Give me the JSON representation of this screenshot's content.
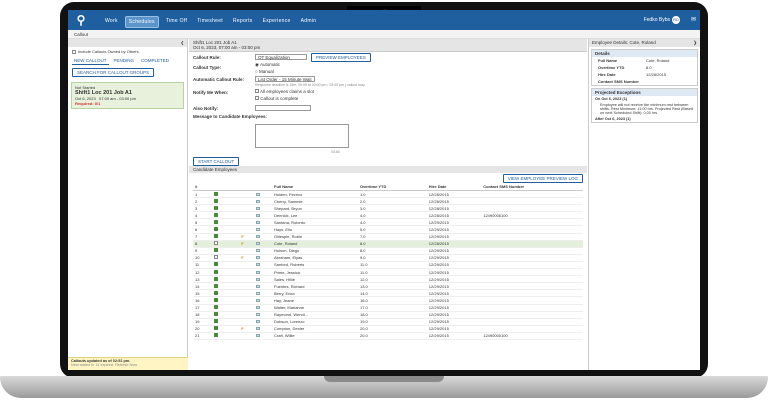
{
  "nav": {
    "items": [
      "Work",
      "Schedules",
      "Time Off",
      "Timesheet",
      "Reports",
      "Experience",
      "Admin"
    ],
    "active_index": 1
  },
  "header": {
    "user": "Fedko Bybs",
    "badge": "RD"
  },
  "breadcrumb": "Callout",
  "left": {
    "include_label": "Include Callouts Owned by Others",
    "tabs": [
      "NEW CALLOUT",
      "PENDING",
      "COMPLETED"
    ],
    "search_button": "SEARCH FOR CALLOUT GROUPS",
    "card": {
      "status": "Not Started",
      "title": "Shift1 Loc 201 Job A1",
      "date": "Oct 6, 2023",
      "time": "07:00 am - 03:00 pm",
      "req": "Required: 0/1"
    },
    "status_text": "Callouts updated as of 02:51 pm.",
    "status_sub": "New added in 14 expired. Refresh Now"
  },
  "main": {
    "title": "Shift1 Loc 201 Job A1",
    "subtitle": "Oct 6, 2023, 07:00 am - 03:00 pm",
    "callout_rule_label": "Callout Rule:",
    "callout_rule_value": "OT Equalization",
    "preview_button": "PREVIEW EMPLOYEES",
    "callout_type_label": "Callout Type:",
    "type_options": [
      "Automatic",
      "Manual"
    ],
    "auto_rule_label": "Automatic Callout Rule:",
    "auto_rule_value": "List Order - 15 Minute Wait",
    "auto_note": "Response deadline is 15m, 00:05 at 03:00 pm / 03:00 pm ( callout may",
    "notify_label": "Notify Me When:",
    "notify_options": [
      "All employees claims a slot",
      "Callout is complete"
    ],
    "also_notify_label": "Also Notify:",
    "message_label": "Message to Candidate Employees:",
    "char_count": "0/160",
    "start_button": "START CALLOUT",
    "section_title": "Candidate Employees",
    "log_button": "VIEW EMPLOYEE PREVIEW LOG",
    "columns": [
      "#",
      "",
      "",
      "",
      "",
      "Full Name",
      "Overtime YTD",
      "Hire Date",
      "Contact SMS Number"
    ],
    "rows": [
      {
        "n": "1",
        "c": true,
        "f": "",
        "name": "Holden, Pevrivo",
        "ot": "1.0",
        "hire": "12/28/2015",
        "sms": ""
      },
      {
        "n": "2",
        "c": true,
        "f": "",
        "name": "Cherry, Sammie",
        "ot": "2.0",
        "hire": "12/28/2015",
        "sms": ""
      },
      {
        "n": "3",
        "c": true,
        "f": "",
        "name": "Shepard, Bryon",
        "ot": "3.0",
        "hire": "12/28/2015",
        "sms": ""
      },
      {
        "n": "4",
        "c": true,
        "f": "",
        "name": "Dennick, Lee",
        "ot": "4.0",
        "hire": "12/28/2015",
        "sms": "12490006100"
      },
      {
        "n": "5",
        "c": true,
        "f": "",
        "name": "Santana, Roberto",
        "ot": "4.0",
        "hire": "12/29/2015",
        "sms": ""
      },
      {
        "n": "6",
        "c": true,
        "f": "",
        "name": "Hays, Elio",
        "ot": "5.0",
        "hire": "12/29/2015",
        "sms": ""
      },
      {
        "n": "7",
        "c": true,
        "f": "F",
        "name": "Gillespie, Robin",
        "ot": "7.0",
        "hire": "12/29/2015",
        "sms": ""
      },
      {
        "n": "8",
        "c": false,
        "f": "F",
        "name": "Cote, Roland",
        "ot": "8.0",
        "hire": "12/28/2015",
        "sms": "",
        "hl": true
      },
      {
        "n": "9",
        "c": true,
        "f": "",
        "name": "Holson, Diego",
        "ot": "8.0",
        "hire": "12/29/2015",
        "sms": ""
      },
      {
        "n": "10",
        "c": false,
        "f": "F",
        "name": "Abraham, Elyas",
        "ot": "9.0",
        "hire": "12/29/2015",
        "sms": ""
      },
      {
        "n": "11",
        "c": true,
        "f": "",
        "name": "Sanford, Roberts",
        "ot": "11.0",
        "hire": "12/29/2015",
        "sms": ""
      },
      {
        "n": "12",
        "c": true,
        "f": "",
        "name": "Prime, Jessica",
        "ot": "11.0",
        "hire": "12/29/2015",
        "sms": ""
      },
      {
        "n": "13",
        "c": true,
        "f": "",
        "name": "Sales, Hillie",
        "ot": "12.0",
        "hire": "12/29/2015",
        "sms": ""
      },
      {
        "n": "14",
        "c": true,
        "f": "",
        "name": "Fuentes, Richard",
        "ot": "13.0",
        "hire": "12/29/2015",
        "sms": ""
      },
      {
        "n": "15",
        "c": true,
        "f": "",
        "name": "Berry, Erica",
        "ot": "14.0",
        "hire": "12/29/2015",
        "sms": ""
      },
      {
        "n": "16",
        "c": true,
        "f": "",
        "name": "Hay, Jeane",
        "ot": "16.0",
        "hire": "12/29/2015",
        "sms": ""
      },
      {
        "n": "17",
        "c": true,
        "f": "",
        "name": "Walter, Marianne",
        "ot": "17.0",
        "hire": "12/29/2015",
        "sms": ""
      },
      {
        "n": "18",
        "c": true,
        "f": "",
        "name": "Raymond, Wendi...",
        "ot": "18.0",
        "hire": "12/29/2015",
        "sms": ""
      },
      {
        "n": "19",
        "c": true,
        "f": "",
        "name": "Dobson, Lorenzo",
        "ot": "19.0",
        "hire": "12/29/2015",
        "sms": ""
      },
      {
        "n": "20",
        "c": true,
        "f": "F",
        "name": "Compton, Dexter",
        "ot": "20.0",
        "hire": "12/29/2015",
        "sms": ""
      },
      {
        "n": "21",
        "c": true,
        "f": "",
        "name": "Craft, Willie",
        "ot": "20.0",
        "hire": "12/29/2015",
        "sms": "12490000100"
      }
    ]
  },
  "right": {
    "title": "Employee Details: Cote, Roland",
    "details_header": "Details",
    "details": [
      {
        "k": "Full Name",
        "v": "Cote, Roland"
      },
      {
        "k": "Overtime YTD",
        "v": "8.0"
      },
      {
        "k": "Hire Date",
        "v": "12/28/2015"
      }
    ],
    "contact": "Contact SMS Number",
    "exceptions_header": "Projected Exceptions",
    "exc_date": "On Oct 6, 2023 (1)",
    "exc_text": "Employee will not receive the minimum rest between shifts. Rest Minimum: 11:00 hrs. Projected Rest (Based on next Scheduled Shift): 0.00 hrs",
    "after_date": "After Oct 6, 2023 (1)"
  }
}
